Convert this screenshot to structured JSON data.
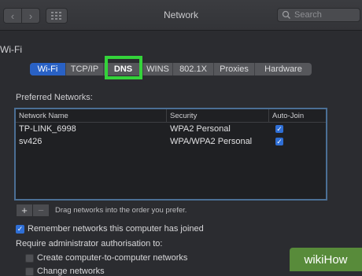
{
  "window": {
    "title": "Network"
  },
  "search": {
    "placeholder": "Search"
  },
  "section": {
    "label": "Wi-Fi"
  },
  "tabs": [
    {
      "label": "Wi-Fi"
    },
    {
      "label": "TCP/IP"
    },
    {
      "label": "DNS"
    },
    {
      "label": "WINS"
    },
    {
      "label": "802.1X"
    },
    {
      "label": "Proxies"
    },
    {
      "label": "Hardware"
    }
  ],
  "preferred": {
    "title": "Preferred Networks:",
    "columns": [
      "Network Name",
      "Security",
      "Auto-Join"
    ],
    "rows": [
      {
        "name": "TP-LINK_6998",
        "security": "WPA2 Personal",
        "auto_join": true
      },
      {
        "name": "sv426",
        "security": "WPA/WPA2 Personal",
        "auto_join": true
      }
    ]
  },
  "controls": {
    "add": "+",
    "remove": "−",
    "drag_hint": "Drag networks into the order you prefer."
  },
  "options": {
    "remember": {
      "label": "Remember networks this computer has joined",
      "checked": true
    },
    "require_label": "Require administrator authorisation to:",
    "create": {
      "label": "Create computer-to-computer networks",
      "checked": false
    },
    "change": {
      "label": "Change networks",
      "checked": false
    }
  },
  "watermark": {
    "text": "wikiHow"
  },
  "colors": {
    "accent": "#2961c4",
    "highlight": "#34d33a",
    "watermark": "#5d963c"
  }
}
